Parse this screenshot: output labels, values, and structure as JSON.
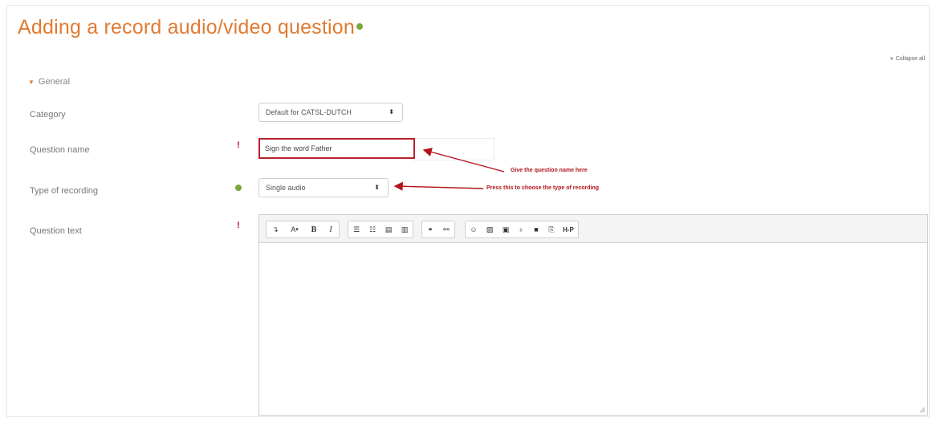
{
  "page": {
    "title": "Adding a record audio/video question",
    "collapse_all": "Collapse all",
    "section_general": "General"
  },
  "fields": {
    "category": {
      "label": "Category",
      "value": "Default for CATSL-DUTCH"
    },
    "question_name": {
      "label": "Question name",
      "value": "Sign the word Father"
    },
    "type_of_recording": {
      "label": "Type of recording",
      "value": "Single audio"
    },
    "question_text": {
      "label": "Question text"
    }
  },
  "annotations": {
    "question_name": "Give the question name here",
    "recording_type": "Press this to choose the type of recording"
  },
  "toolbar": {
    "buttons": [
      [
        "show-more-buttons",
        "format-text",
        "bold",
        "italic"
      ],
      [
        "unordered-list",
        "ordered-list",
        "outdent",
        "indent"
      ],
      [
        "link",
        "unlink"
      ],
      [
        "emoji",
        "image",
        "media",
        "record-audio",
        "record-video",
        "manage-files",
        "h5p"
      ]
    ],
    "labels": {
      "text_format": "A",
      "bold": "B",
      "italic": "I",
      "h5p": "H-P"
    }
  },
  "colors": {
    "title": "#e07b32",
    "required": "#b3141a",
    "help": "#7ba73a",
    "annotation": "#b3141a"
  }
}
